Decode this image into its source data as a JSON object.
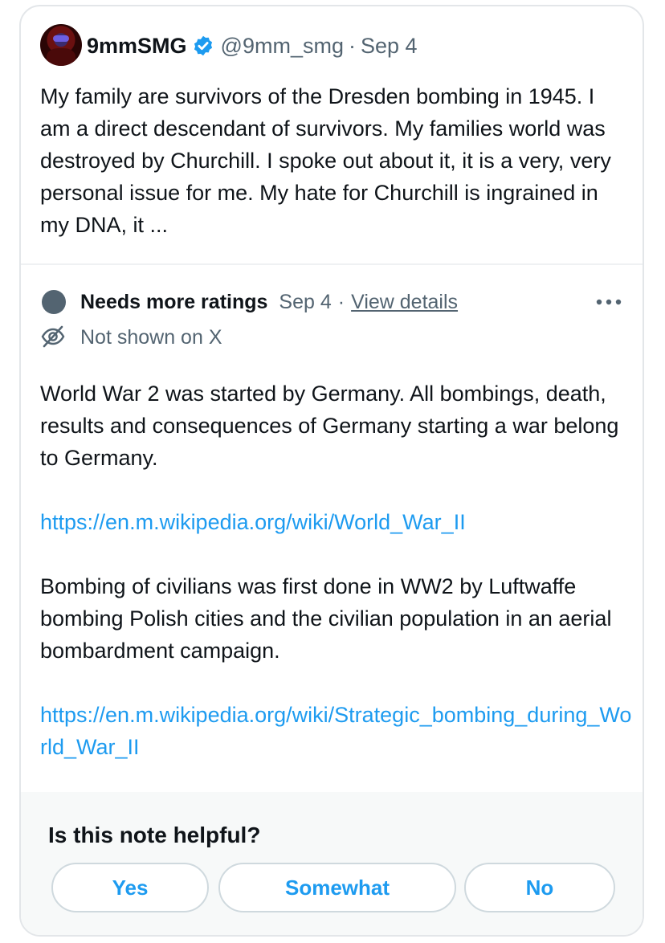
{
  "tweet": {
    "author": "9mmSMG",
    "handle": "@9mm_smg",
    "separator": "·",
    "date": "Sep 4",
    "text": "My family are survivors of the Dresden bombing in 1945. I am a direct descendant of survivors. My families world was destroyed by Churchill. I spoke out about it, it is a very, very personal issue for me. My hate for Churchill is ingrained in my DNA, it ...",
    "verified_color": "#1d9bf0"
  },
  "note": {
    "status": "Needs more ratings",
    "date": "Sep 4",
    "separator": "·",
    "view_details": "View details",
    "visibility": "Not shown on X",
    "paragraph1": "World War 2 was started by Germany.  All bombings, death, results and consequences of Germany starting a war belong to Germany.",
    "link1": "https://en.m.wikipedia.org/wiki/World_War_II",
    "paragraph2": "Bombing of civilians was first done in WW2 by Luftwaffe bombing Polish cities and the civilian population in an aerial bombardment campaign.",
    "link2": "https://en.m.wikipedia.org/wiki/Strategic_bombing_during_World_War_II",
    "link_color": "#1d9bf0",
    "status_dot_color": "#536471",
    "icons": [
      "more-options-icon",
      "eye-slash-icon",
      "verified-badge-icon"
    ]
  },
  "rating": {
    "question": "Is this note helpful?",
    "yes": "Yes",
    "somewhat": "Somewhat",
    "no": "No"
  }
}
